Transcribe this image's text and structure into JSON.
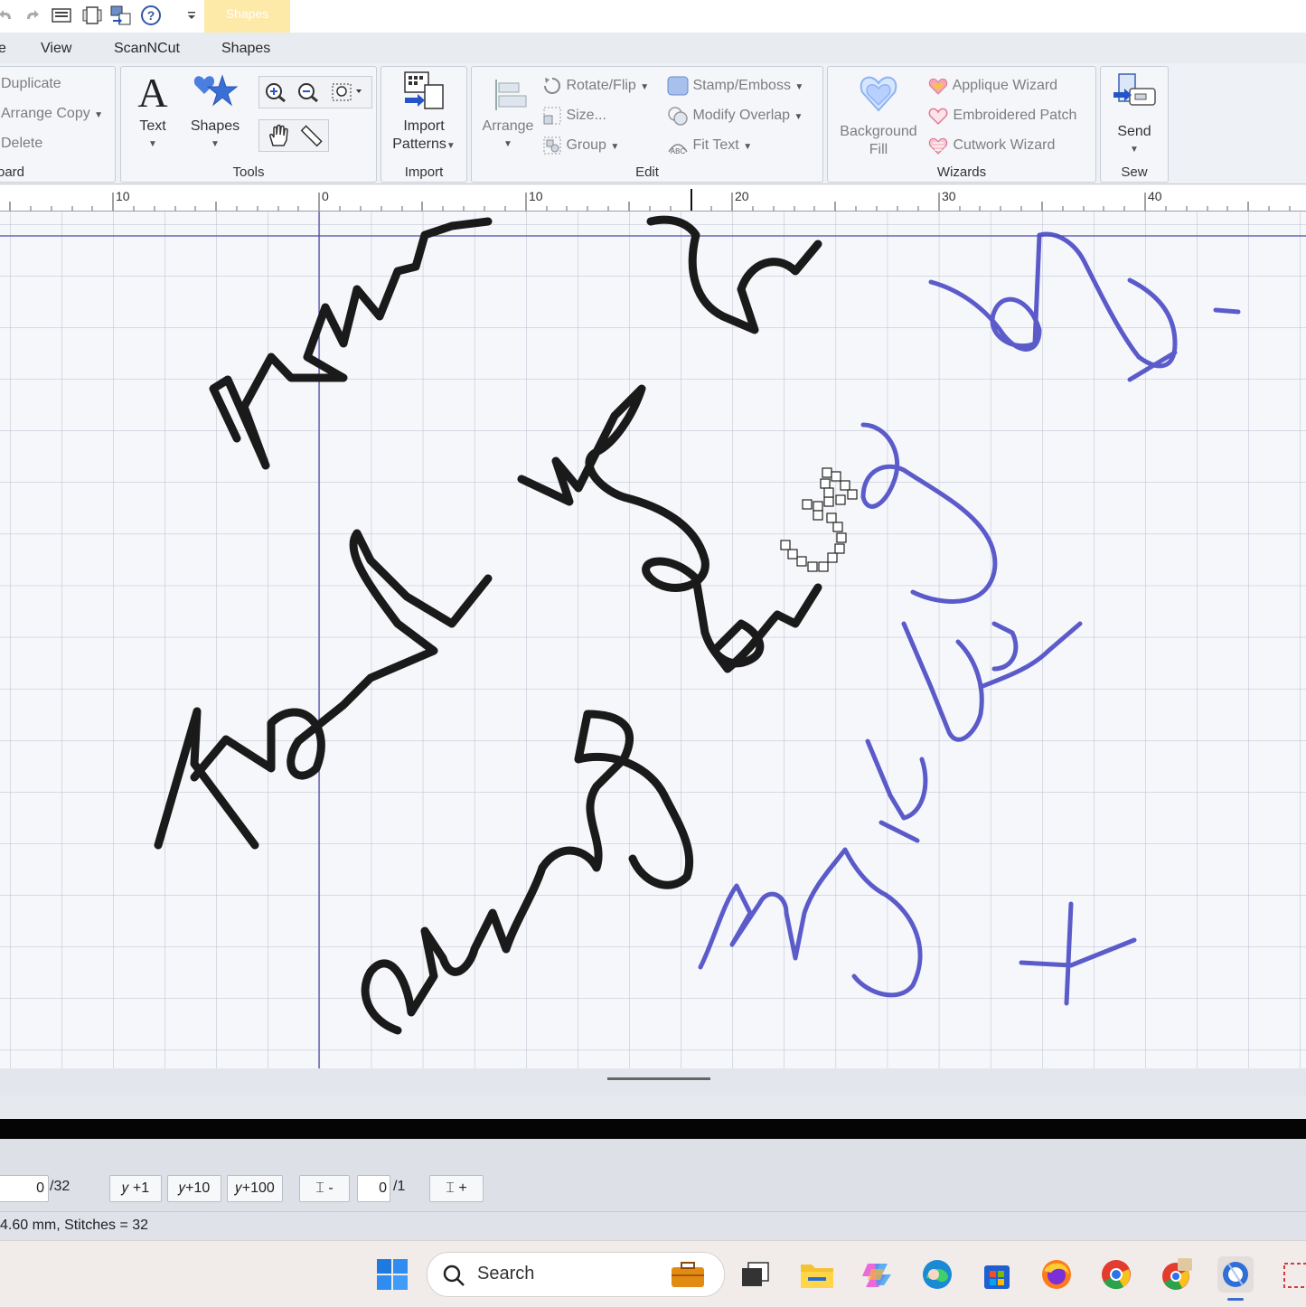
{
  "qat": {
    "context_tab": "Shapes"
  },
  "tabs": [
    "e",
    "View",
    "ScanNCut",
    "Shapes"
  ],
  "ribbon": {
    "clipboard": {
      "items": [
        "Duplicate",
        "Arrange Copy",
        "Delete"
      ],
      "label": "oard"
    },
    "tools": {
      "text_label": "Text",
      "shapes_label": "Shapes",
      "label": "Tools"
    },
    "import": {
      "button_line1": "Import",
      "button_line2": "Patterns",
      "label": "Import"
    },
    "edit": {
      "arrange": "Arrange",
      "rotate_flip": "Rotate/Flip",
      "size": "Size...",
      "group": "Group",
      "stamp_emboss": "Stamp/Emboss",
      "modify_overlap": "Modify Overlap",
      "fit_text": "Fit Text",
      "label": "Edit"
    },
    "wizards": {
      "background_fill_1": "Background",
      "background_fill_2": "Fill",
      "applique": "Applique Wizard",
      "embroidered_patch": "Embroidered Patch",
      "cutwork": "Cutwork Wizard",
      "label": "Wizards"
    },
    "sew": {
      "send": "Send",
      "label": "Sew"
    }
  },
  "ruler": {
    "ticks": [
      "10",
      "0",
      "10",
      "20",
      "30",
      "40"
    ]
  },
  "stitch_bar": {
    "stitch_value": "0",
    "stitch_total": "/32",
    "plus1": "+1",
    "plus10": "+10",
    "plus100": "+100",
    "minus": "-",
    "color_value": "0",
    "color_total": "/1",
    "plus": "+"
  },
  "status": {
    "text": "4.60 mm, Stitches = 32"
  },
  "taskbar": {
    "search_placeholder": "Search"
  },
  "colors": {
    "black_ink": "#1a1a1a",
    "blue_ink": "#4a4ac4",
    "grid": "#b9bdcc",
    "ribbon_bg": "#eef1f6"
  }
}
